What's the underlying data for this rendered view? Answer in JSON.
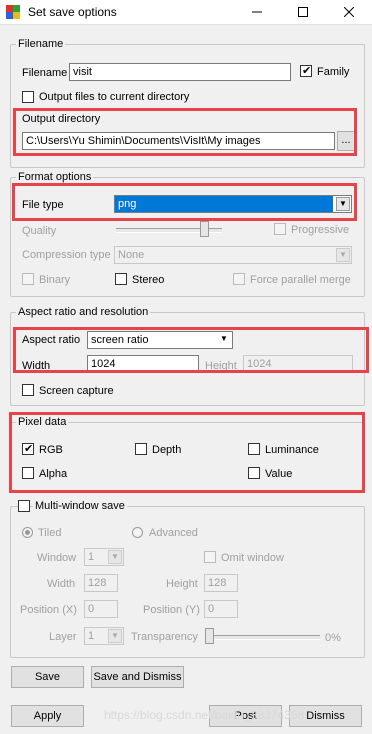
{
  "window": {
    "title": "Set save options"
  },
  "filename_group": {
    "title": "Filename",
    "filename_label": "Filename",
    "filename_value": "visit",
    "family_label": "Family",
    "family_checked": true,
    "output_current_label": "Output files to current directory",
    "output_dir_label": "Output directory",
    "output_dir_value": "C:\\Users\\Yu Shimin\\Documents\\VisIt\\My images",
    "browse_label": "..."
  },
  "format_group": {
    "title": "Format options",
    "file_type_label": "File type",
    "file_type_value": "png",
    "quality_label": "Quality",
    "progressive_label": "Progressive",
    "compression_label": "Compression type",
    "compression_value": "None",
    "binary_label": "Binary",
    "stereo_label": "Stereo",
    "force_parallel_label": "Force parallel merge"
  },
  "aspect_group": {
    "title": "Aspect ratio and resolution",
    "aspect_label": "Aspect ratio",
    "aspect_value": "screen ratio",
    "width_label": "Width",
    "width_value": "1024",
    "height_label": "Height",
    "height_value": "1024",
    "screen_capture_label": "Screen capture"
  },
  "pixel_group": {
    "title": "Pixel data",
    "rgb_label": "RGB",
    "rgb_checked": true,
    "depth_label": "Depth",
    "luminance_label": "Luminance",
    "alpha_label": "Alpha",
    "value_label": "Value"
  },
  "multi_group": {
    "title": "Multi-window save",
    "tiled_label": "Tiled",
    "advanced_label": "Advanced",
    "window_label": "Window",
    "window_value": "1",
    "omit_label": "Omit window",
    "width_label": "Width",
    "width_value": "128",
    "height_label": "Height",
    "height_value": "128",
    "posx_label": "Position (X)",
    "posx_value": "0",
    "posy_label": "Position (Y)",
    "posy_value": "0",
    "layer_label": "Layer",
    "layer_value": "1",
    "transparency_label": "Transparency",
    "transparency_value": "0%"
  },
  "buttons": {
    "save": "Save",
    "save_dismiss": "Save and Dismiss",
    "apply": "Apply",
    "post": "Post",
    "dismiss": "Dismiss"
  },
  "watermark": "https://blog.csdn.net/baidu_38374358",
  "colors": {
    "highlight": "#e8434b",
    "selection": "#0078d7"
  }
}
